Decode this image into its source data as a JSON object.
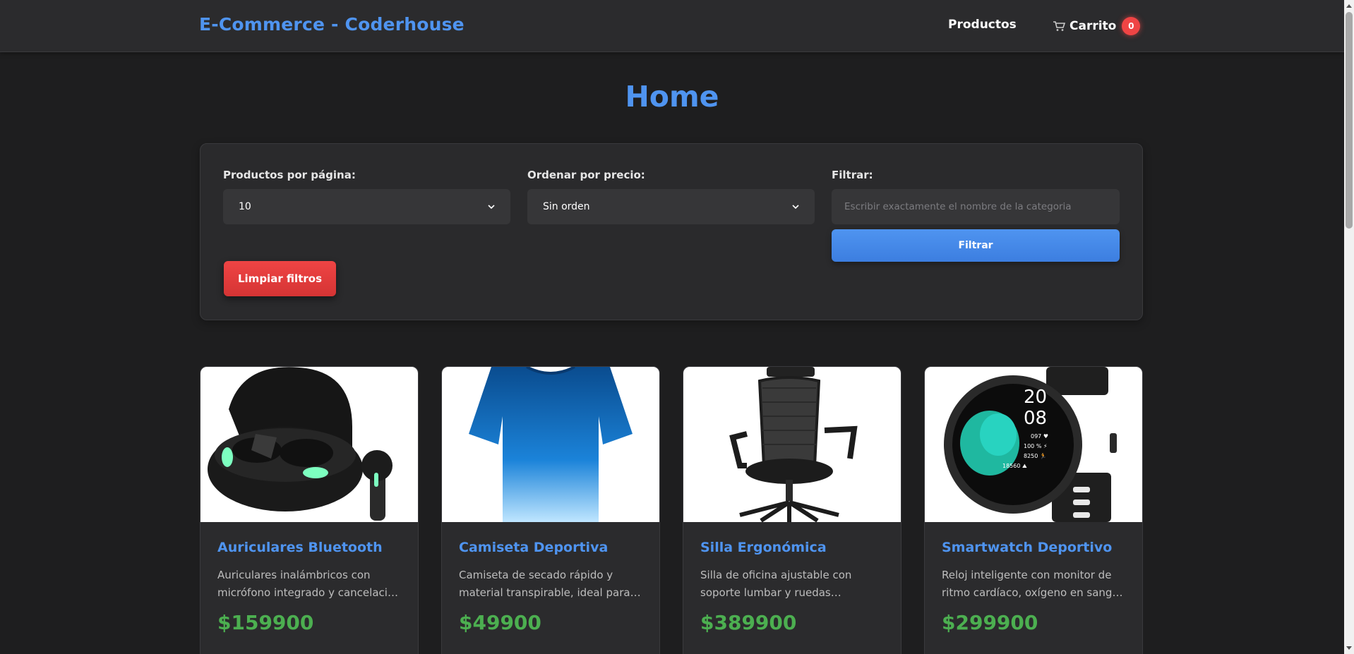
{
  "navbar": {
    "brand": "E-Commerce - Coderhouse",
    "products_link": "Productos",
    "cart_label": "Carrito",
    "cart_count": "0",
    "cart_icon": "shopping-cart-icon"
  },
  "page": {
    "title": "Home"
  },
  "filters": {
    "per_page_label": "Productos por página:",
    "per_page_value": "10",
    "sort_label": "Ordenar por precio:",
    "sort_value": "Sin orden",
    "filter_label": "Filtrar:",
    "filter_placeholder": "Escribir exactamente el nombre de la categoria",
    "filter_button": "Filtrar",
    "clear_button": "Limpiar filtros"
  },
  "products": [
    {
      "name": "Auriculares Bluetooth",
      "description": "Auriculares inalámbricos con micrófono integrado y cancelación de ruido",
      "price": "$159900",
      "image": "earbuds-image"
    },
    {
      "name": "Camiseta Deportiva",
      "description": "Camiseta de secado rápido y material transpirable, ideal para entrenamiento",
      "price": "$49900",
      "image": "tshirt-image"
    },
    {
      "name": "Silla Ergonómica",
      "description": "Silla de oficina ajustable con soporte lumbar y ruedas giratorias",
      "price": "$389900",
      "image": "office-chair-image"
    },
    {
      "name": "Smartwatch Deportivo",
      "description": "Reloj inteligente con monitor de ritmo cardíaco, oxígeno en sangre y GPS",
      "price": "$299900",
      "image": "smartwatch-image",
      "watch_face": {
        "hour": "20",
        "minute": "08",
        "stats": [
          "097 ♥",
          "100 % ⚡",
          "8250 🏃",
          "18560 ⛰"
        ]
      }
    }
  ],
  "colors": {
    "accent": "#4f94f0",
    "price": "#4caf50",
    "danger": "#ef4444",
    "background": "#1e1e1f",
    "card": "#2b2b2d"
  }
}
